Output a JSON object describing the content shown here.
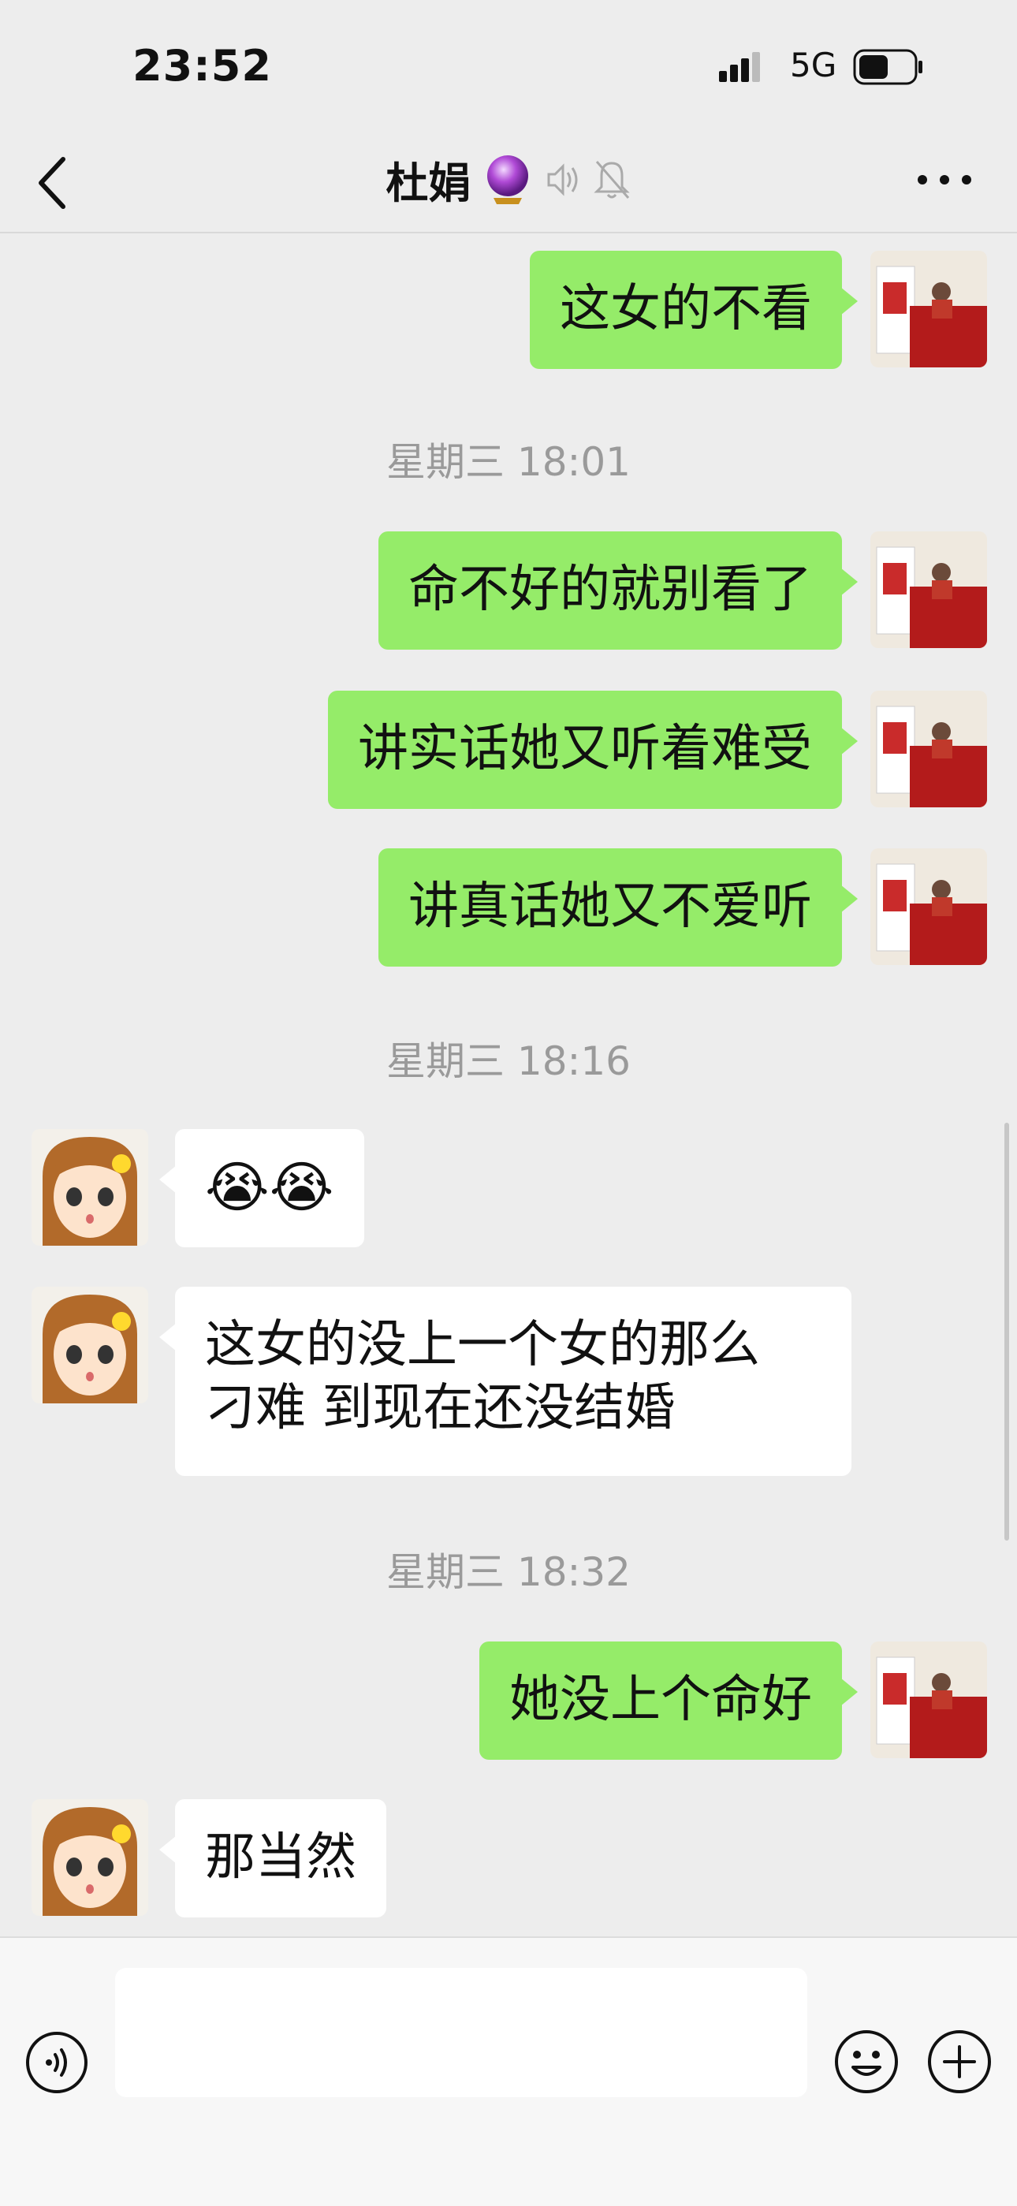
{
  "status_bar": {
    "time": "23:52",
    "network": "5G"
  },
  "nav": {
    "title": "杜娟",
    "title_icons": [
      "crystal-ball-icon",
      "voice-icon",
      "muted-bell-icon"
    ]
  },
  "messages": [
    {
      "type": "me",
      "text": "这女的不看"
    },
    {
      "type": "time",
      "text": "星期三 18:01"
    },
    {
      "type": "me",
      "text": "命不好的就别看了"
    },
    {
      "type": "me",
      "text": "讲实话她又听着难受"
    },
    {
      "type": "me",
      "text": "讲真话她又不爱听"
    },
    {
      "type": "time",
      "text": "星期三 18:16"
    },
    {
      "type": "them",
      "text": "😭😭"
    },
    {
      "type": "them",
      "line1": "这女的没上一个女的那么",
      "line2": "刁难 到现在还没结婚"
    },
    {
      "type": "time",
      "text": "星期三 18:32"
    },
    {
      "type": "me",
      "text": "她没上个命好"
    },
    {
      "type": "them",
      "text": "那当然"
    }
  ],
  "colors": {
    "my_bubble": "#95ec69",
    "their_bubble": "#ffffff",
    "background": "#ededed"
  }
}
